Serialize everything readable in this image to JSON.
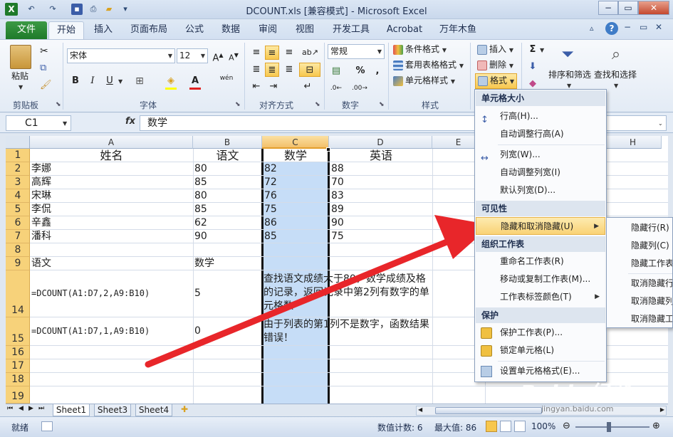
{
  "window": {
    "title": "DCOUNT.xls  [兼容模式] - Microsoft Excel",
    "controls": [
      "−",
      "▭",
      "✕"
    ]
  },
  "ribbon_tabs": [
    "文件",
    "开始",
    "插入",
    "页面布局",
    "公式",
    "数据",
    "审阅",
    "视图",
    "开发工具",
    "Acrobat",
    "万年木鱼"
  ],
  "ribbon": {
    "paste_label": "粘贴",
    "clipboard_label": "剪贴板",
    "font_name": "宋体",
    "font_size": "12",
    "font_label": "字体",
    "align_label": "对齐方式",
    "number_format": "常规",
    "number_label": "数字",
    "styles": {
      "conditional": "条件格式",
      "table": "套用表格格式",
      "cell_styles": "单元格样式",
      "label": "样式"
    },
    "cells": {
      "insert": "插入",
      "delete": "删除",
      "format": "格式"
    },
    "editing": {
      "sort": "排序和筛选",
      "find": "查找和选择",
      "sigma": "Σ"
    },
    "bold": "B",
    "italic": "I",
    "underline": "U",
    "percent": "%",
    "comma": ",",
    "wen": "wén"
  },
  "formula_bar": {
    "name_box": "C1",
    "fx": "fx",
    "content": "数学"
  },
  "columns": [
    "A",
    "B",
    "C",
    "D",
    "E",
    "H"
  ],
  "rows": [
    "1",
    "2",
    "3",
    "4",
    "5",
    "6",
    "7",
    "8",
    "9",
    "14",
    "15",
    "16",
    "17",
    "18",
    "19"
  ],
  "cells": {
    "header": [
      "姓名",
      "语文",
      "数学",
      "英语"
    ],
    "data": [
      [
        "李娜",
        "80",
        "82",
        "88"
      ],
      [
        "高辉",
        "85",
        "72",
        "70"
      ],
      [
        "宋琳",
        "80",
        "76",
        "83"
      ],
      [
        "李侃",
        "85",
        "75",
        "89"
      ],
      [
        "辛鑫",
        "62",
        "86",
        "90"
      ],
      [
        "潘科",
        "90",
        "85",
        "75"
      ]
    ],
    "r9a": "语文",
    "r9b": "数学",
    "r14a": "=DCOUNT(A1:D7,2,A9:B10)",
    "r14b": "5",
    "r14c": "查找语文成绩大于80，数学成绩及格的记录，返回记录中第2列有数字的单元格数",
    "r15a": "=DCOUNT(A1:D7,1,A9:B10)",
    "r15b": "0",
    "r15c": "由于列表的第1列不是数字，函数结果错误！"
  },
  "sheet_tabs": [
    "Sheet1",
    "Sheet3",
    "Sheet4"
  ],
  "status": {
    "ready": "就绪",
    "count": "数值计数: 6",
    "max": "最大值: 86",
    "zoom": "100%"
  },
  "format_menu": {
    "section_size": "单元格大小",
    "row_height": "行高(H)...",
    "autofit_row": "自动调整行高(A)",
    "col_width": "列宽(W)...",
    "autofit_col": "自动调整列宽(I)",
    "default_width": "默认列宽(D)...",
    "section_visibility": "可见性",
    "hide_unhide": "隐藏和取消隐藏(U)",
    "section_organize": "组织工作表",
    "rename": "重命名工作表(R)",
    "move_copy": "移动或复制工作表(M)...",
    "tab_color": "工作表标签颜色(T)",
    "section_protect": "保护",
    "protect_sheet": "保护工作表(P)...",
    "lock_cell": "锁定单元格(L)",
    "format_cells": "设置单元格格式(E)..."
  },
  "submenu": [
    "隐藏行(R)",
    "隐藏列(C)",
    "隐藏工作表",
    "取消隐藏行",
    "取消隐藏列",
    "取消隐藏工"
  ],
  "watermark": {
    "logo": "Baidu经验",
    "url": "jingyan.baidu.com"
  },
  "colors": {
    "accent_file": "#1e7a2a",
    "selection": "#c6ddf7",
    "header_sel": "#f3c06b",
    "arrow": "#e8262a"
  }
}
